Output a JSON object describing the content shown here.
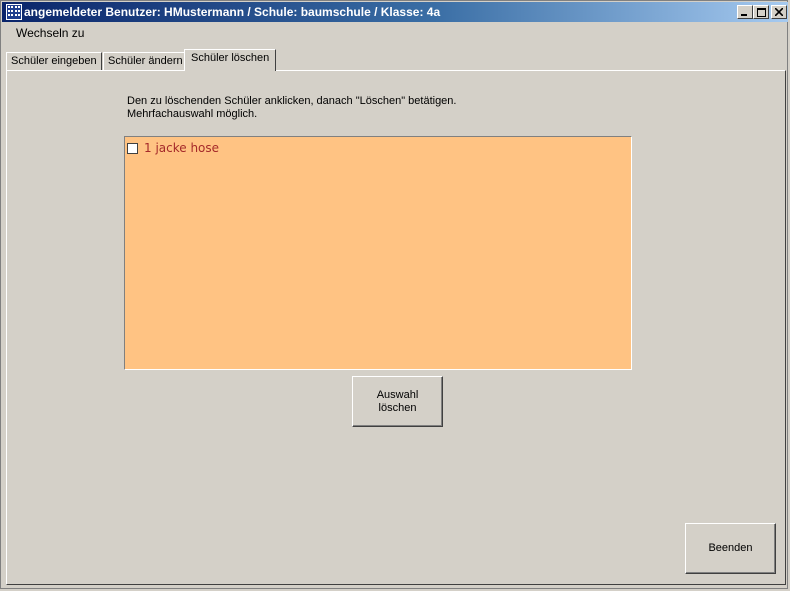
{
  "window": {
    "title": "angemeldeter Benutzer: HMustermann / Schule: baumschule / Klasse: 4a",
    "controls": [
      "minimize-icon",
      "maximize-icon",
      "close-icon"
    ]
  },
  "menu": {
    "items": [
      {
        "label": "Wechseln zu"
      }
    ]
  },
  "tabs": [
    {
      "label": "Schüler eingeben",
      "active": false
    },
    {
      "label": "Schüler ändern",
      "active": false
    },
    {
      "label": "Schüler löschen",
      "active": true
    }
  ],
  "panel": {
    "instruction_line1": "Den zu löschenden Schüler anklicken, danach \"Löschen\" betätigen.",
    "instruction_line2": "Mehrfachauswahl möglich.",
    "list": {
      "background": "#ffc383",
      "items": [
        {
          "label": "1 jacke hose",
          "checked": false
        }
      ]
    },
    "delete_button": {
      "line1": "Auswahl",
      "line2": "löschen"
    }
  },
  "footer": {
    "exit_button": "Beenden"
  }
}
